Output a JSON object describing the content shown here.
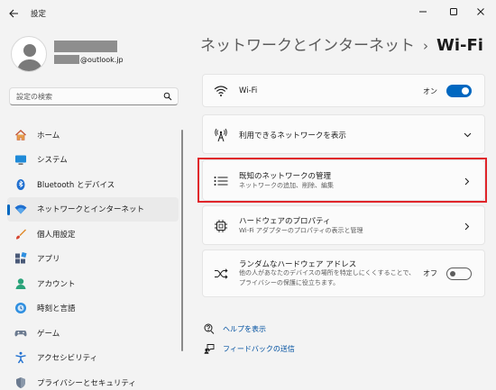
{
  "window": {
    "title": "設定",
    "back_icon": "back-arrow-icon",
    "controls": [
      "minimize-icon",
      "maximize-icon",
      "close-icon"
    ]
  },
  "account": {
    "email_suffix": "@outlook.jp"
  },
  "search": {
    "placeholder": "設定の検索"
  },
  "sidebar": {
    "items": [
      {
        "label": "ホーム",
        "icon": "home-icon",
        "active": false
      },
      {
        "label": "システム",
        "icon": "system-icon",
        "active": false
      },
      {
        "label": "Bluetooth とデバイス",
        "icon": "bluetooth-icon",
        "active": false
      },
      {
        "label": "ネットワークとインターネット",
        "icon": "network-icon",
        "active": true
      },
      {
        "label": "個人用設定",
        "icon": "personalization-icon",
        "active": false
      },
      {
        "label": "アプリ",
        "icon": "apps-icon",
        "active": false
      },
      {
        "label": "アカウント",
        "icon": "account-icon",
        "active": false
      },
      {
        "label": "時刻と言語",
        "icon": "time-language-icon",
        "active": false
      },
      {
        "label": "ゲーム",
        "icon": "gaming-icon",
        "active": false
      },
      {
        "label": "アクセシビリティ",
        "icon": "accessibility-icon",
        "active": false
      },
      {
        "label": "プライバシーとセキュリティ",
        "icon": "privacy-shield-icon",
        "active": false
      }
    ]
  },
  "header": {
    "parent": "ネットワークとインターネット",
    "separator": "›",
    "current": "Wi-Fi"
  },
  "cards": {
    "wifi": {
      "title": "Wi-Fi",
      "toggle_text": "オン",
      "toggle_on": true
    },
    "available": {
      "title": "利用できるネットワークを表示"
    },
    "known": {
      "title": "既知のネットワークの管理",
      "subtitle": "ネットワークの追加、削除、編集"
    },
    "hardware": {
      "title": "ハードウェアのプロパティ",
      "subtitle": "Wi-Fi アダプターのプロパティの表示と管理"
    },
    "random": {
      "title": "ランダムなハードウェア アドレス",
      "subtitle_lines": [
        "他の人があなたのデバイスの場所を特定しにくくすることで、",
        "プライバシーの保護に役立ちます。"
      ],
      "toggle_text": "オフ",
      "toggle_on": false
    }
  },
  "links": {
    "help": "ヘルプを表示",
    "feedback": "フィードバックの送信"
  },
  "colors": {
    "accent": "#0067c0",
    "highlight": "#e0252a",
    "background": "#f3f3f3",
    "card": "#fbfbfb"
  }
}
